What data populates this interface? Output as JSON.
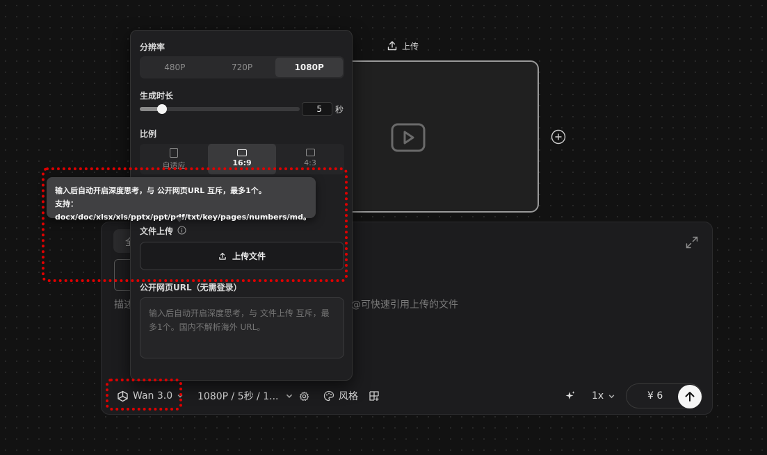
{
  "top_upload": {
    "label": "上传",
    "icon": "upload-icon"
  },
  "video_preview": {
    "icon": "play-icon"
  },
  "add_button": {
    "icon": "plus-circle-icon"
  },
  "prompt_panel": {
    "chip_label": "全",
    "placeholder_left": "描述",
    "placeholder_right": "@可快速引用上传的文件",
    "expand_icon": "expand-icon"
  },
  "toolbar": {
    "model": "Wan 3.0",
    "settings_summary": "1080P / 5秒 / 1...",
    "style_label": "风格",
    "speed": "1x",
    "price": "¥ 6",
    "icons": [
      "model-logo-icon",
      "chevron-down-icon",
      "gear-icon",
      "palette-icon",
      "grid-plus-icon",
      "sparkle-icon",
      "arrow-up-icon"
    ]
  },
  "popover": {
    "resolution": {
      "label": "分辨率",
      "options": [
        "480P",
        "720P",
        "1080P"
      ],
      "selected": "1080P"
    },
    "duration": {
      "label": "生成时长",
      "value": "5",
      "unit": "秒",
      "fraction": 0.14
    },
    "ratio": {
      "label": "比例",
      "options": [
        "自适应",
        "16:9",
        "4:3"
      ],
      "selected": "16:9"
    },
    "file_upload": {
      "label": "文件上传",
      "button": "上传文件"
    },
    "url": {
      "label": "公开网页URL（无需登录）",
      "placeholder": "输入后自动开启深度思考，与 文件上传 互斥，最多1个。国内不解析海外 URL。"
    }
  },
  "tooltip": {
    "line1": "输入后自动开启深度思考，与 公开网页URL 互斥，最多1个。",
    "line2": "支持：docx/doc/xlsx/xls/pptx/ppt/pdf/txt/key/pages/numbers/md。",
    "partial": "5"
  },
  "colors": {
    "background": "#121212",
    "panel": "#1c1c1e",
    "popover": "#1f1f21",
    "tooltip": "#404042",
    "highlight": "#e00000"
  }
}
